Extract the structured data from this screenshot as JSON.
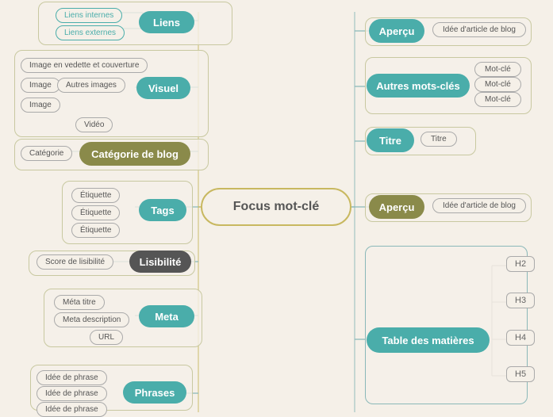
{
  "center": {
    "label": "Focus mot-clé"
  },
  "left_groups": [
    {
      "id": "liens",
      "main_label": "Liens",
      "main_style": "node-teal",
      "sub_items": [
        "Liens internes",
        "Liens externes"
      ]
    },
    {
      "id": "visuel",
      "main_label": "Visuel",
      "main_style": "node-teal",
      "sub_items": [
        "Image en vedette et couverture",
        "Image",
        "Autres images",
        "Image",
        "Vidéo"
      ]
    },
    {
      "id": "categorie",
      "main_label": "Catégorie de blog",
      "main_style": "node-olive",
      "sub_items": [
        "Catégorie"
      ]
    },
    {
      "id": "tags",
      "main_label": "Tags",
      "main_style": "node-teal",
      "sub_items": [
        "Étiquette",
        "Étiquette",
        "Étiquette"
      ]
    },
    {
      "id": "lisibilite",
      "main_label": "Lisibilité",
      "main_style": "node-dark",
      "sub_items": [
        "Score de lisibilité"
      ]
    },
    {
      "id": "meta",
      "main_label": "Meta",
      "main_style": "node-teal",
      "sub_items": [
        "Méta titre",
        "Meta description",
        "URL"
      ]
    },
    {
      "id": "phrases",
      "main_label": "Phrases",
      "main_style": "node-teal",
      "sub_items": [
        "Idée de phrase",
        "Idée de phrase",
        "Idée de phrase"
      ]
    }
  ],
  "right_groups": [
    {
      "id": "apercu1",
      "main_label": "Aperçu",
      "main_style": "node-teal",
      "sub_items": [
        "Idée d'article de blog"
      ]
    },
    {
      "id": "autres_mots",
      "main_label": "Autres mots-clés",
      "main_style": "node-teal",
      "sub_items": [
        "Mot-clé",
        "Mot-clé",
        "Mot-clé"
      ]
    },
    {
      "id": "titre",
      "main_label": "Titre",
      "main_style": "node-teal",
      "sub_items": [
        "Titre"
      ]
    },
    {
      "id": "apercu2",
      "main_label": "Aperçu",
      "main_style": "node-olive",
      "sub_items": [
        "Idée d'article de blog"
      ]
    },
    {
      "id": "table",
      "main_label": "Table des matières",
      "main_style": "node-teal",
      "sub_items": [
        "H2",
        "H3",
        "H4",
        "H5"
      ]
    }
  ]
}
